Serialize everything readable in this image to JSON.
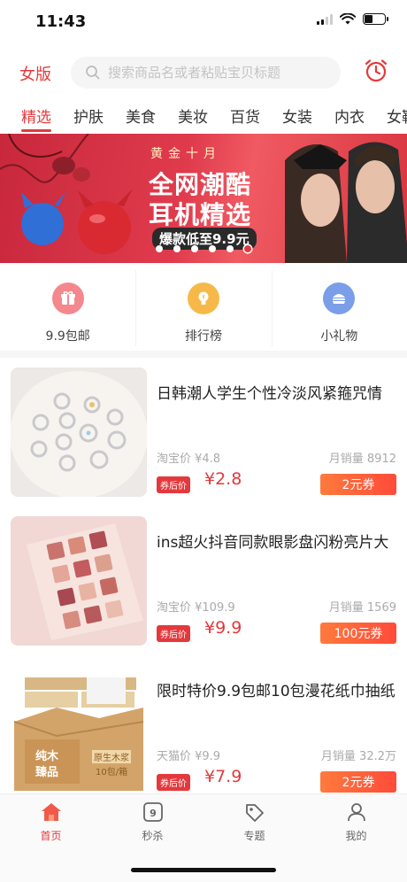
{
  "status_bar": {
    "time": "11:43"
  },
  "header": {
    "gender_label": "女版",
    "search_placeholder": "搜索商品名或者粘贴宝贝标题"
  },
  "category_tabs": [
    {
      "label": "精选",
      "active": true
    },
    {
      "label": "护肤"
    },
    {
      "label": "美食"
    },
    {
      "label": "美妆"
    },
    {
      "label": "百货"
    },
    {
      "label": "女装"
    },
    {
      "label": "内衣"
    },
    {
      "label": "女鞋"
    }
  ],
  "banner": {
    "kicker": "黄金十月",
    "title_line1": "全网潮酷",
    "title_line2": "耳机精选",
    "pill": "爆款低至9.9元",
    "dots_total": 6,
    "dot_active_index": 5
  },
  "quick_nav": [
    {
      "label": "9.9包邮",
      "icon": "gift-icon",
      "color": "#f27c84"
    },
    {
      "label": "排行榜",
      "icon": "bulb-icon",
      "color": "#f5b544"
    },
    {
      "label": "小礼物",
      "icon": "burger-icon",
      "color": "#6d93e8"
    }
  ],
  "products": [
    {
      "title": "日韩潮人学生个性冷淡风紧箍咒情",
      "orig_price_label": "淘宝价 ¥4.8",
      "monthly_sales_label": "月销量 8912",
      "after_coupon_badge": "券后价",
      "final_price": "¥2.8",
      "coupon_label": "2元券",
      "thumb_icon": "rings-image"
    },
    {
      "title": "ins超火抖音同款眼影盘闪粉亮片大",
      "orig_price_label": "淘宝价 ¥109.9",
      "monthly_sales_label": "月销量 1569",
      "after_coupon_badge": "券后价",
      "final_price": "¥9.9",
      "coupon_label": "100元券",
      "thumb_icon": "eyeshadow-palette-image"
    },
    {
      "title": "限时特价9.9包邮10包漫花纸巾抽纸",
      "orig_price_label": "天猫价 ¥9.9",
      "monthly_sales_label": "月销量 32.2万",
      "after_coupon_badge": "券后价",
      "final_price": "¥7.9",
      "coupon_label": "2元券",
      "thumb_icon": "tissue-box-image",
      "thumb_box_text1": "纯木",
      "thumb_box_text2": "臻品",
      "thumb_box_text3": "原生木浆",
      "thumb_box_text4": "10包/箱"
    }
  ],
  "tabbar": [
    {
      "label": "首页",
      "icon": "home-icon",
      "active": true
    },
    {
      "label": "秒杀",
      "icon": "flash-sale-icon"
    },
    {
      "label": "专题",
      "icon": "tag-icon"
    },
    {
      "label": "我的",
      "icon": "user-icon"
    }
  ],
  "colors": {
    "accent": "#e4393c",
    "coupon": "#ff5a3a"
  }
}
